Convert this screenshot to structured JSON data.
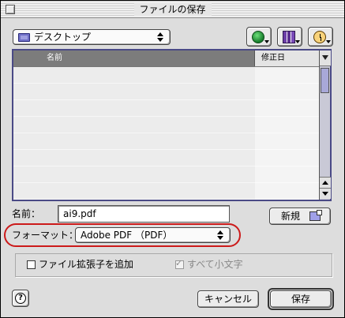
{
  "window": {
    "title": "ファイルの保存"
  },
  "location": {
    "label": "デスクトップ",
    "icon": "folder-icon"
  },
  "toolbar": {
    "buttons": [
      {
        "name": "network-globe-icon"
      },
      {
        "name": "favorites-books-icon"
      },
      {
        "name": "recent-clock-icon"
      }
    ]
  },
  "filelist": {
    "columns": [
      "名前",
      "修正日"
    ],
    "rows": []
  },
  "name_field": {
    "label": "名前：",
    "value": "ai9.pdf"
  },
  "new_button": {
    "label": "新規"
  },
  "format": {
    "label": "フォーマット：",
    "value": "Adobe PDF （PDF）",
    "highlight_color": "#cc1a1a"
  },
  "options": {
    "append_extension": {
      "label": "ファイル拡張子を追加",
      "checked": false,
      "enabled": true
    },
    "lowercase": {
      "label": "すべて小文字",
      "checked": true,
      "enabled": false
    }
  },
  "buttons": {
    "cancel": "キャンセル",
    "save": "保存"
  }
}
